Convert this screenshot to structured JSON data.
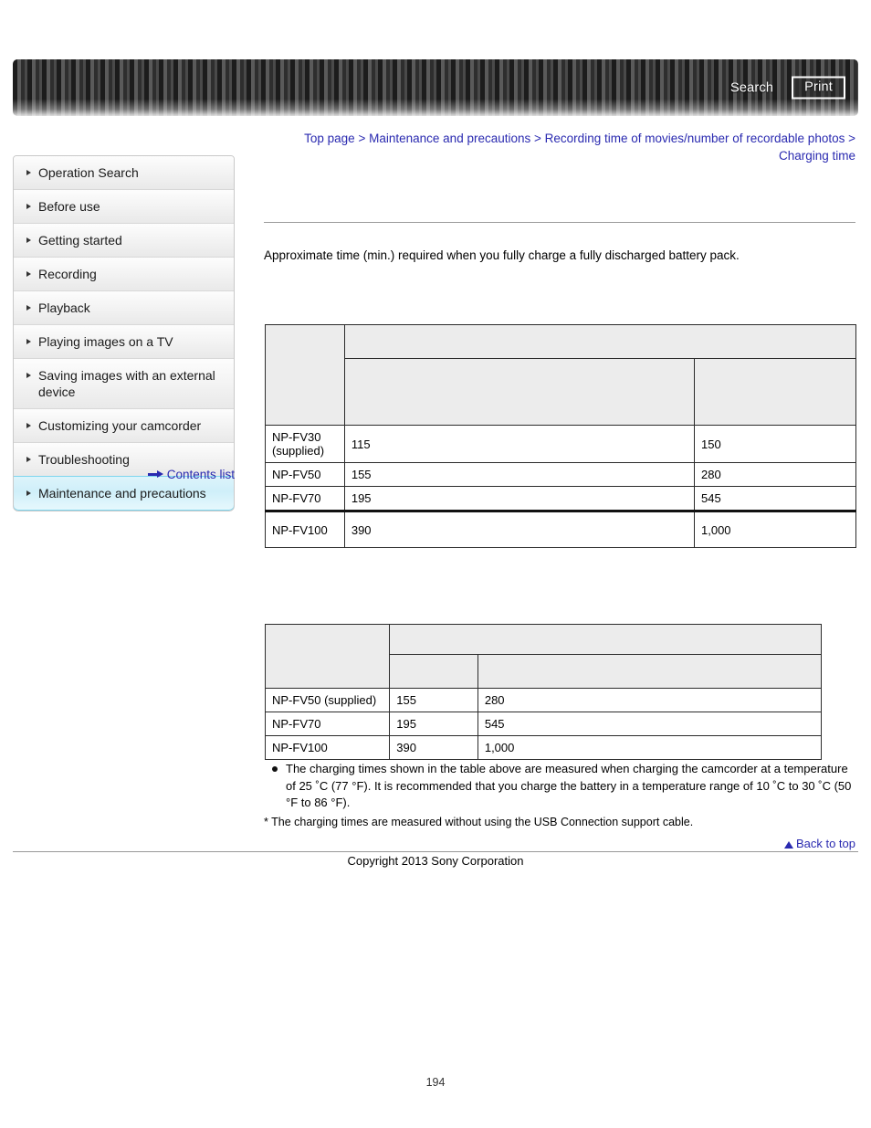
{
  "header": {
    "search_label": "Search",
    "print_label": "Print",
    "search_icon": "search-icon",
    "print_icon": "print-icon"
  },
  "breadcrumb": {
    "items": [
      "Top page",
      "Maintenance and precautions",
      "Recording time of movies/number of recordable photos",
      "Charging time"
    ],
    "separator": ">"
  },
  "sidebar": {
    "items": [
      {
        "label": "Operation Search",
        "active": false
      },
      {
        "label": "Before use",
        "active": false
      },
      {
        "label": "Getting started",
        "active": false
      },
      {
        "label": "Recording",
        "active": false
      },
      {
        "label": "Playback",
        "active": false
      },
      {
        "label": "Playing images on a TV",
        "active": false
      },
      {
        "label": "Saving images with an external device",
        "active": false
      },
      {
        "label": "Customizing your camcorder",
        "active": false
      },
      {
        "label": "Troubleshooting",
        "active": false
      },
      {
        "label": "Maintenance and precautions",
        "active": true
      }
    ],
    "contents_list_label": "Contents list",
    "contents_list_icon": "arrow-right-icon"
  },
  "main": {
    "intro": "Approximate time (min.) required when you fully charge a fully discharged battery pack.",
    "table1": {
      "header_row1": [
        "",
        ""
      ],
      "header_row2": [
        "",
        "",
        ""
      ],
      "rows": [
        {
          "model": "NP-FV30 (supplied)",
          "usb": "115",
          "ac": "150"
        },
        {
          "model": "NP-FV50",
          "usb": "155",
          "ac": "280"
        },
        {
          "model": "NP-FV70",
          "usb": "195",
          "ac": "545"
        },
        {
          "model": "NP-FV100",
          "usb": "390",
          "ac": "1,000"
        }
      ]
    },
    "table2": {
      "header_row1": [
        "",
        ""
      ],
      "header_row2": [
        "",
        "",
        ""
      ],
      "rows": [
        {
          "model": "NP-FV50 (supplied)",
          "usb": "155",
          "ac": "280"
        },
        {
          "model": "NP-FV70",
          "usb": "195",
          "ac": "545"
        },
        {
          "model": "NP-FV100",
          "usb": "390",
          "ac": "1,000"
        }
      ]
    },
    "notes": [
      "The charging times shown in the table above are measured when charging the camcorder at a temperature of 25 ˚C (77 °F). It is recommended that you charge the battery in a temperature range of 10 ˚C to 30 ˚C (50 °F to 86 °F)."
    ],
    "footnote": "* The charging times are measured without using the USB Connection support cable."
  },
  "footer": {
    "back_to_top_label": "Back to top",
    "back_to_top_icon": "triangle-up-icon",
    "copyright": "Copyright 2013 Sony Corporation",
    "page_number": "194"
  },
  "colors": {
    "link": "#2a2ab0",
    "header_bar": "#3a3a3a",
    "active_item": "#cfeff9"
  }
}
